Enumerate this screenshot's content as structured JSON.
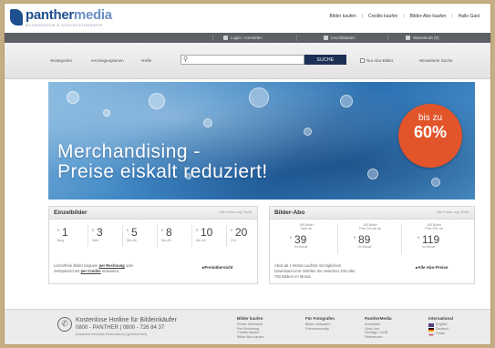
{
  "header": {
    "logo_primary": "panther",
    "logo_secondary": "media",
    "logo_tagline": "BILDAGENTUR & STOCKFOTOGRAFIE",
    "nav": [
      "Bilder kaufen",
      "Credits kaufen",
      "Bilder-Abo kaufen",
      "Hallo Gast"
    ],
    "account": [
      "Login / Anmelden",
      "Leuchtkasten",
      "Warenkorb (0)"
    ]
  },
  "search": {
    "filters": [
      "Kategorien",
      "Anzeigeoptionen",
      "Hilfe"
    ],
    "placeholder": "",
    "button": "SUCHE",
    "options": [
      "Nur Abo-Bilder",
      "Erweiterte Suche"
    ]
  },
  "banner": {
    "line1": "Merchandising -",
    "line2": "Preise eiskalt reduziert!",
    "badge_top": "bis zu",
    "badge_value": "60%"
  },
  "single_images": {
    "title": "Einzelbilder",
    "note": "* alle Preise zzgl. MwSt.",
    "prices": [
      {
        "cur": "€",
        "value": "1",
        "label": "Blog"
      },
      {
        "cur": "€",
        "value": "3",
        "label": "Web"
      },
      {
        "cur": "€",
        "value": "5",
        "label": "Din-A6"
      },
      {
        "cur": "€",
        "value": "8",
        "label": "Din-A5"
      },
      {
        "cur": "€",
        "value": "10",
        "label": "Din-A4"
      },
      {
        "cur": "€",
        "value": "20",
        "label": "XXL"
      }
    ],
    "desc_a": "Lizenzfreie Bilder bequem",
    "desc_b": "per Rechnung",
    "desc_c": "oder",
    "desc_d": "zeitsparend mit",
    "desc_e": "per Credits",
    "desc_f": "einkaufen.",
    "link": "Preisübersicht"
  },
  "subscription": {
    "title": "Bilder-Abo",
    "note": "* alle Preise zzgl. MwSt.",
    "plans": [
      {
        "top1": "150 Bilder",
        "top2": "Web ab",
        "cur": "€",
        "value": "39",
        "label": "im Monat"
      },
      {
        "top1": "150 Bilder",
        "top2": "Print Din-A6 ab",
        "cur": "€",
        "value": "89",
        "label": "im Monat"
      },
      {
        "top1": "150 Bilder",
        "top2": "Print XXL ab",
        "cur": "€",
        "value": "119",
        "label": "im Monat"
      }
    ],
    "desc_1": "Abos ab 1 Monat Laufzeit mit täglichem",
    "desc_2": "Download-Limit. Wählen Sie zwischen 100 oder",
    "desc_3": "750 Bildern im Monat.",
    "link": "Alle Abo-Preise"
  },
  "footer": {
    "hotline_title": "Kostenlose Hotline für Bildeinkäufer",
    "hotline_phone": "0800 - PANTHER  |  0800 - 726 84 37",
    "hotline_note": "(kostenfrei innerhalb Deutschlands) (gebührenfrei)",
    "columns": [
      {
        "title": "Bilder kaufen",
        "links": [
          "Preise Übersicht",
          "Per Rechnung",
          "Credits kaufen",
          "Bilder Abo kaufen"
        ]
      },
      {
        "title": "Für Fotografen",
        "links": [
          "Bilder verkaufen",
          "Fotocommunity"
        ]
      },
      {
        "title": "PantherMedia",
        "links": [
          "Anmelden",
          "Über Uns",
          "Verträge / AGB",
          "Referenzen"
        ]
      }
    ],
    "international_title": "International",
    "languages": [
      "English",
      "Deutsch",
      "Polski"
    ]
  }
}
